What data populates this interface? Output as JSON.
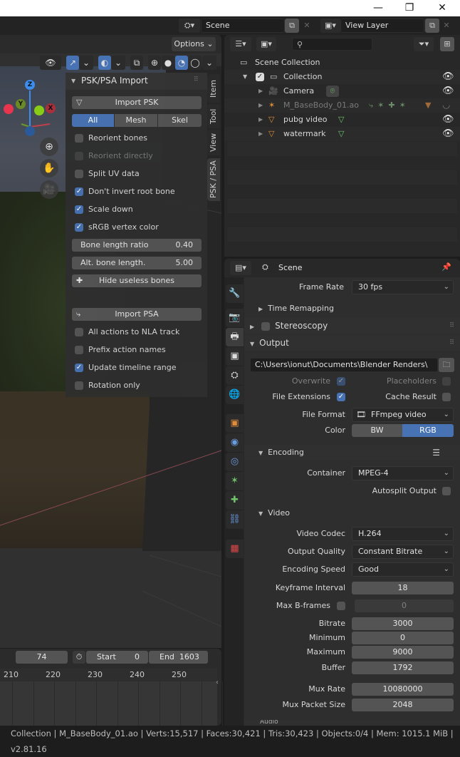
{
  "window": {
    "minimize": "—",
    "maximize": "❐",
    "close": "✕"
  },
  "topbar": {
    "scene_value": "Scene",
    "view_layer_value": "View Layer"
  },
  "viewport": {
    "options_label": "Options",
    "gizmo": {
      "z": "Z",
      "y": "Y",
      "x": "X"
    },
    "nav": [
      "zoom",
      "pan",
      "camera"
    ]
  },
  "npanel": {
    "title": "PSK/PSA Import",
    "import_psk": "Import PSK",
    "segments": [
      {
        "label": "All",
        "active": true
      },
      {
        "label": "Mesh",
        "active": false
      },
      {
        "label": "Skel",
        "active": false
      }
    ],
    "psk_options": [
      {
        "label": "Reorient bones",
        "checked": false,
        "disabled": false
      },
      {
        "label": "Reorient directly",
        "checked": false,
        "disabled": true
      },
      {
        "label": "Split UV data",
        "checked": false,
        "disabled": false
      },
      {
        "label": "Don't invert root bone",
        "checked": true,
        "disabled": false
      },
      {
        "label": "Scale down",
        "checked": true,
        "disabled": false
      },
      {
        "label": "sRGB vertex color",
        "checked": true,
        "disabled": false
      }
    ],
    "bone_length_ratio": {
      "label": "Bone length ratio",
      "value": "0.40"
    },
    "alt_bone_length": {
      "label": "Alt. bone length.",
      "value": "5.00"
    },
    "hide_useless_bones": "Hide useless bones",
    "import_psa": "Import PSA",
    "psa_options": [
      {
        "label": "All actions to NLA track",
        "checked": false
      },
      {
        "label": "Prefix action names",
        "checked": false
      },
      {
        "label": "Update timeline range",
        "checked": true
      },
      {
        "label": "Rotation only",
        "checked": false
      }
    ],
    "tabs": [
      {
        "label": "Item",
        "active": false
      },
      {
        "label": "Tool",
        "active": false
      },
      {
        "label": "View",
        "active": false
      },
      {
        "label": "PSK / PSA",
        "active": true
      }
    ]
  },
  "timeline": {
    "current_frame": "74",
    "start_label": "Start",
    "start_value": "0",
    "end_label": "End",
    "end_value": "1603",
    "ruler": [
      "210",
      "220",
      "230",
      "240",
      "250"
    ]
  },
  "outliner": {
    "search_placeholder": "",
    "scene_collection": "Scene Collection",
    "items": [
      {
        "name": "Collection",
        "type": "collection",
        "visible": true
      },
      {
        "name": "Camera",
        "type": "camera",
        "visible": true
      },
      {
        "name": "M_BaseBody_01.ao",
        "type": "armature",
        "visible": false
      },
      {
        "name": "pubg video",
        "type": "mesh",
        "visible": true
      },
      {
        "name": "watermark",
        "type": "mesh",
        "visible": true
      }
    ]
  },
  "properties": {
    "context": "Scene",
    "frame_rate": {
      "label": "Frame Rate",
      "value": "30 fps"
    },
    "time_remapping": "Time Remapping",
    "stereoscopy": "Stereoscopy",
    "output": {
      "title": "Output",
      "path": "C:\\Users\\ionut\\Documents\\Blender Renders\\",
      "overwrite": {
        "label": "Overwrite",
        "checked": true
      },
      "placeholders": {
        "label": "Placeholders",
        "checked": false
      },
      "file_extensions": {
        "label": "File Extensions",
        "checked": true
      },
      "cache_result": {
        "label": "Cache Result",
        "checked": false
      },
      "file_format": {
        "label": "File Format",
        "value": "FFmpeg video"
      },
      "color": {
        "label": "Color",
        "options": [
          "BW",
          "RGB"
        ],
        "selected": "RGB"
      }
    },
    "encoding": {
      "title": "Encoding",
      "container": {
        "label": "Container",
        "value": "MPEG-4"
      },
      "autosplit": {
        "label": "Autosplit Output",
        "checked": false
      }
    },
    "video": {
      "title": "Video",
      "codec": {
        "label": "Video Codec",
        "value": "H.264"
      },
      "quality": {
        "label": "Output Quality",
        "value": "Constant Bitrate"
      },
      "speed": {
        "label": "Encoding Speed",
        "value": "Good"
      },
      "keyframe": {
        "label": "Keyframe Interval",
        "value": "18"
      },
      "bframes": {
        "label": "Max B-frames",
        "value": "0",
        "checked": false
      },
      "bitrate": {
        "label": "Bitrate",
        "value": "3000"
      },
      "minimum": {
        "label": "Minimum",
        "value": "0"
      },
      "maximum": {
        "label": "Maximum",
        "value": "9000"
      },
      "buffer": {
        "label": "Buffer",
        "value": "1792"
      },
      "mux_rate": {
        "label": "Mux Rate",
        "value": "10080000"
      },
      "mux_packet": {
        "label": "Mux Packet Size",
        "value": "2048"
      }
    },
    "audio": "Audio"
  },
  "status": "Collection | M_BaseBody_01.ao | Verts:15,517 | Faces:30,421 | Tris:30,423 | Objects:0/4 | Mem: 1015.1 MiB | v2.81.16",
  "colors": {
    "accent": "#4772b3",
    "object_orange": "#e08c3a",
    "data_green": "#6fc46b"
  }
}
